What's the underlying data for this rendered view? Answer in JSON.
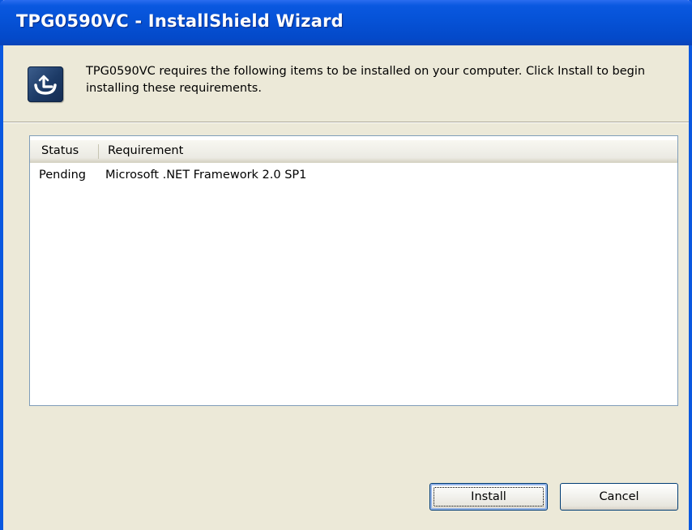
{
  "window": {
    "title": "TPG0590VC - InstallShield Wizard"
  },
  "header": {
    "icon": "installshield-icon",
    "message": "TPG0590VC requires the following items to be installed on your computer. Click Install to begin installing these requirements."
  },
  "requirements_list": {
    "columns": [
      "Status",
      "Requirement"
    ],
    "rows": [
      {
        "status": "Pending",
        "requirement": "Microsoft .NET Framework 2.0 SP1"
      }
    ]
  },
  "buttons": {
    "install_label": "Install",
    "cancel_label": "Cancel"
  },
  "colors": {
    "titlebar": "#0a58e0",
    "dialog_background": "#ece9d8",
    "button_border": "#003c74"
  }
}
